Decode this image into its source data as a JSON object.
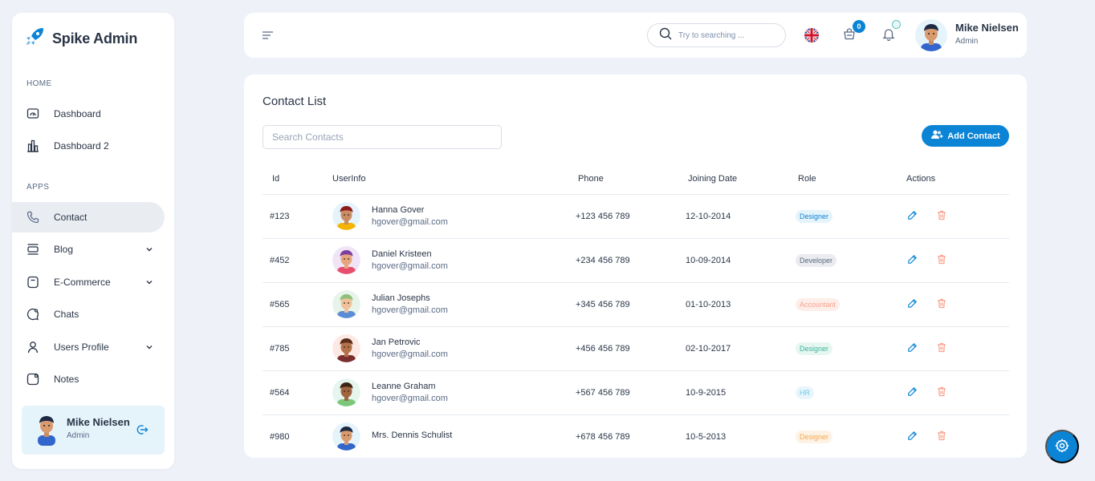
{
  "sidebar": {
    "brand": "Spike Admin",
    "sections": {
      "home": "HOME",
      "apps": "APPS"
    },
    "items": [
      {
        "label": "Dashboard",
        "icon": "monitor-icon"
      },
      {
        "label": "Dashboard 2",
        "icon": "chart-bars-icon"
      },
      {
        "label": "Contact",
        "icon": "phone-icon",
        "active": true
      },
      {
        "label": "Blog",
        "icon": "layout-icon",
        "has_submenu": true
      },
      {
        "label": "E-Commerce",
        "icon": "bag-icon",
        "has_submenu": true
      },
      {
        "label": "Chats",
        "icon": "chat-icon"
      },
      {
        "label": "Users Profile",
        "icon": "user-icon",
        "has_submenu": true
      },
      {
        "label": "Notes",
        "icon": "notes-icon"
      }
    ],
    "profile": {
      "name": "Mike Nielsen",
      "role": "Admin"
    }
  },
  "header": {
    "search_placeholder": "Try to searching ...",
    "cart_count": "0",
    "user": {
      "name": "Mike Nielsen",
      "role": "Admin"
    }
  },
  "main": {
    "title": "Contact List",
    "search_placeholder": "Search Contacts",
    "add_button": "Add Contact",
    "columns": [
      "Id",
      "UserInfo",
      "Phone",
      "Joining Date",
      "Role",
      "Actions"
    ],
    "rows": [
      {
        "id": "#123",
        "name": "Hanna Gover",
        "email": "hgover@gmail.com",
        "phone": "+123 456 789",
        "date": "12-10-2014",
        "role": "Designer",
        "role_color": "#0b84d6",
        "role_bg": "#e5f3fb"
      },
      {
        "id": "#452",
        "name": "Daniel Kristeen",
        "email": "hgover@gmail.com",
        "phone": "+234 456 789",
        "date": "10-09-2014",
        "role": "Developer",
        "role_color": "#5a6a85",
        "role_bg": "#eaecef"
      },
      {
        "id": "#565",
        "name": "Julian Josephs",
        "email": "hgover@gmail.com",
        "phone": "+345 456 789",
        "date": "01-10-2013",
        "role": "Accountant",
        "role_color": "#f8a28f",
        "role_bg": "#fdeee9"
      },
      {
        "id": "#785",
        "name": "Jan Petrovic",
        "email": "hgover@gmail.com",
        "phone": "+456 456 789",
        "date": "02-10-2017",
        "role": "Designer",
        "role_color": "#39b69a",
        "role_bg": "#e6f7f2"
      },
      {
        "id": "#564",
        "name": "Leanne Graham",
        "email": "hgover@gmail.com",
        "phone": "+567 456 789",
        "date": "10-9-2015",
        "role": "HR",
        "role_color": "#6fc6e8",
        "role_bg": "#e8f6fb"
      },
      {
        "id": "#980",
        "name": "Mrs. Dennis Schulist",
        "email": "",
        "phone": "+678 456 789",
        "date": "10-5-2013",
        "role": "Designer",
        "role_color": "#f6a84b",
        "role_bg": "#fdf2e4"
      }
    ]
  },
  "colors": {
    "primary": "#0b84d6",
    "edit": "#0b84d6",
    "delete": "#f8a28f"
  }
}
